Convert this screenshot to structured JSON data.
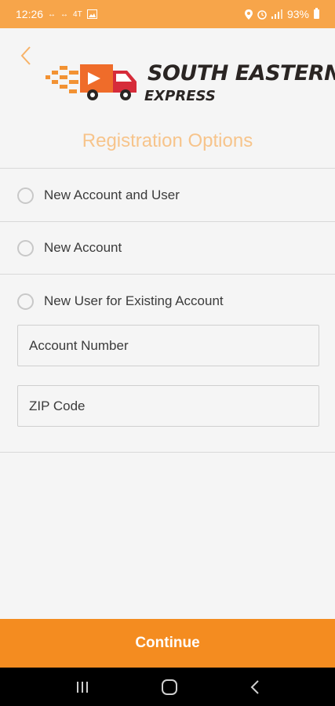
{
  "status_bar": {
    "time": "12:26",
    "left_icons": [
      "↔",
      "↔",
      "4T",
      "image-icon"
    ],
    "right_icons": [
      "location-icon",
      "alarm-icon",
      "signal-icon"
    ],
    "battery": "93%"
  },
  "header": {
    "back_icon": "chevron-left-icon"
  },
  "logo": {
    "name": "SOUTH EASTERN",
    "tagline": "EXPRESS"
  },
  "page": {
    "title": "Registration Options"
  },
  "options": [
    {
      "label": "New Account and User"
    },
    {
      "label": "New Account"
    },
    {
      "label": "New User for Existing Account"
    }
  ],
  "fields": {
    "account_number": {
      "placeholder": "Account Number",
      "value": ""
    },
    "zip_code": {
      "placeholder": "ZIP Code",
      "value": ""
    }
  },
  "footer": {
    "continue_label": "Continue"
  },
  "colors": {
    "accent": "#f48c20",
    "status_bar": "#f7a54a",
    "title": "#f7c48b"
  },
  "nav": {
    "icons": [
      "recents-icon",
      "home-icon",
      "back-icon"
    ]
  }
}
